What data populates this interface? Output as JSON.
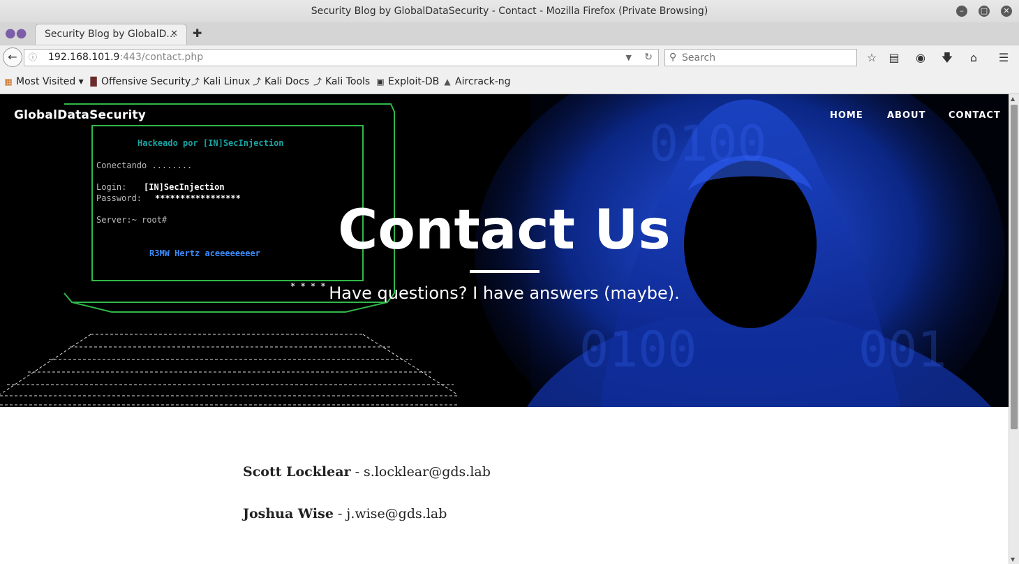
{
  "window": {
    "title": "Security Blog by GlobalDataSecurity - Contact - Mozilla Firefox (Private Browsing)"
  },
  "tabs": [
    {
      "label": "Security Blog by GlobalD..."
    }
  ],
  "urlbar": {
    "host": "192.168.101.9",
    "rest": ":443/contact.php"
  },
  "search": {
    "placeholder": "Search"
  },
  "bookmarks": [
    {
      "label": "Most Visited ▾",
      "icon": "most-visited-icon"
    },
    {
      "label": "Offensive Security",
      "icon": "offsec-icon"
    },
    {
      "label": "Kali Linux",
      "icon": "kali-icon"
    },
    {
      "label": "Kali Docs",
      "icon": "kali-icon"
    },
    {
      "label": "Kali Tools",
      "icon": "kali-icon"
    },
    {
      "label": "Exploit-DB",
      "icon": "exploitdb-icon"
    },
    {
      "label": "Aircrack-ng",
      "icon": "aircrack-icon"
    }
  ],
  "site": {
    "brand": "GlobalDataSecurity",
    "nav": [
      "HOME",
      "ABOUT",
      "CONTACT"
    ]
  },
  "hero": {
    "title": "Contact Us",
    "subtitle": "Have questions? I have answers (maybe).",
    "terminal": {
      "line1": "Hackeado por [IN]SecInjection",
      "line2": "Conectando ........",
      "line3a": "Login:",
      "line3b": "[IN]SecInjection",
      "line4a": "Password:",
      "line4b": "*****************",
      "line5": "Server:~ root#",
      "line6": "R3MW Hertz aceeeeeeeer",
      "stars": "* * * *"
    }
  },
  "contacts": [
    {
      "name": "Scott Locklear",
      "sep": " - ",
      "email": "s.locklear@gds.lab"
    },
    {
      "name": "Joshua Wise",
      "sep": " - ",
      "email": "j.wise@gds.lab"
    }
  ],
  "colors": {
    "hero_bg": "#000000",
    "terminal_green": "#2fb84a",
    "hood_blue": "#1f4fd8",
    "teal_text": "#1aa6a6"
  }
}
